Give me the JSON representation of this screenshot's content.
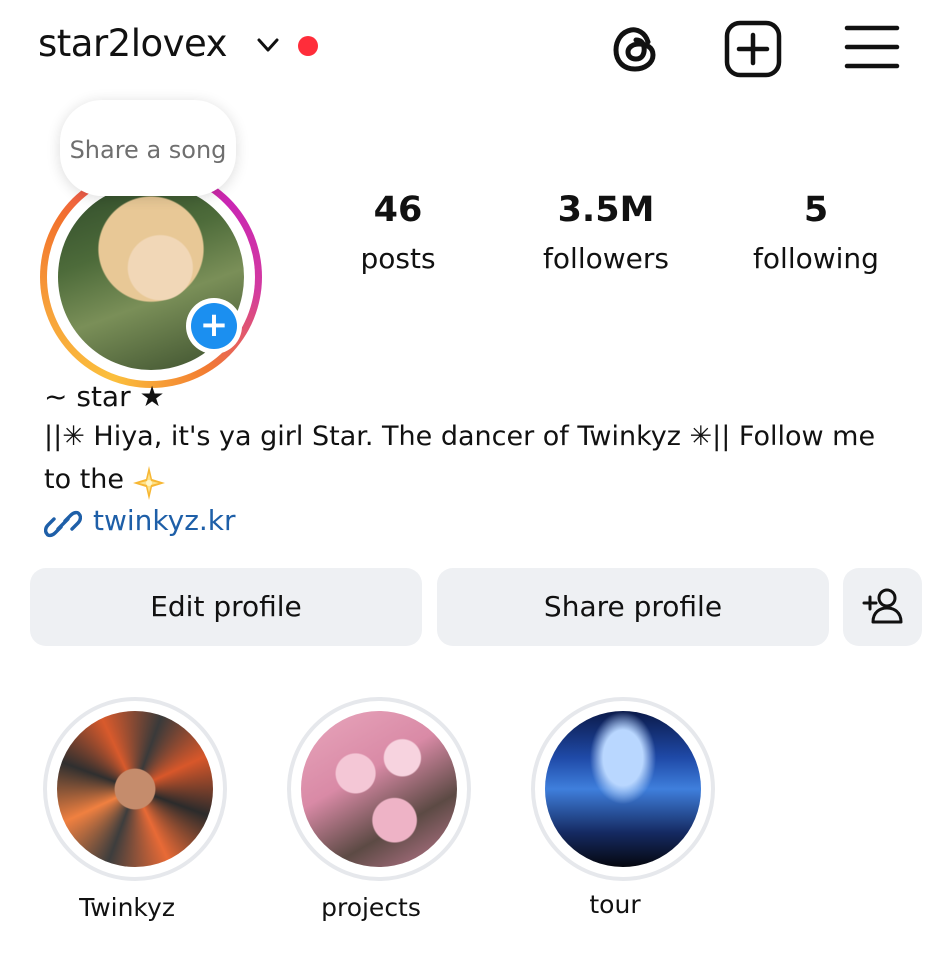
{
  "header": {
    "username": "star2lovex",
    "icons": [
      "chevron-down-icon",
      "notification-dot",
      "threads-icon",
      "new-post-icon",
      "menu-icon"
    ],
    "accent_red": "#ff2d3a"
  },
  "profile": {
    "song_prompt": "Share a song",
    "avatar_add_label": "+",
    "stats": {
      "posts": {
        "value": "46",
        "label": "posts"
      },
      "followers": {
        "value": "3.5M",
        "label": "followers"
      },
      "following": {
        "value": "5",
        "label": "following"
      }
    },
    "display_name": "~ star ★",
    "bio_line1": "||✳ Hiya, it's ya girl Star. The dancer of Twinkyz ✳||  Follow me",
    "bio_line2": "to the",
    "link": "twinkyz.kr",
    "link_color": "#1e5fa8"
  },
  "actions": {
    "edit_label": "Edit profile",
    "share_label": "Share profile"
  },
  "highlights": [
    {
      "label": "Twinkyz"
    },
    {
      "label": "projects"
    },
    {
      "label": "tour"
    }
  ]
}
